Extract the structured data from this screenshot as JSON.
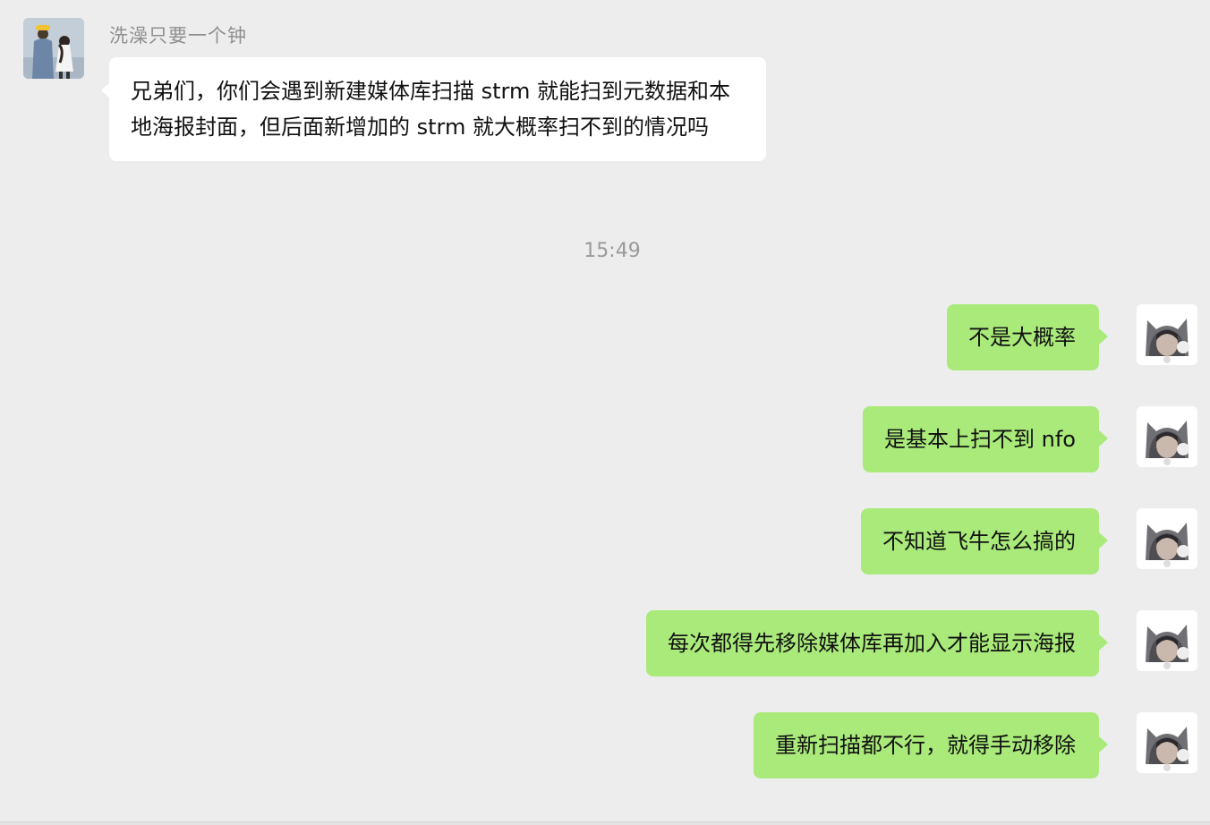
{
  "conversation": {
    "incoming": {
      "sender_name": "洗澡只要一个钟",
      "avatar": "couple-illustration-avatar",
      "text": "兄弟们，你们会遇到新建媒体库扫描 strm 就能扫到元数据和本地海报封面，但后面新增加的 strm 就大概率扫不到的情况吗"
    },
    "timestamp": "15:49",
    "outgoing": [
      {
        "text": "不是大概率"
      },
      {
        "text": "是基本上扫不到 nfo"
      },
      {
        "text": "不知道飞牛怎么搞的"
      },
      {
        "text": "每次都得先移除媒体库再加入才能显示海报"
      },
      {
        "text": "重新扫描都不行，就得手动移除"
      }
    ],
    "my_avatar": "girl-with-cat-hood-avatar"
  },
  "colors": {
    "background": "#ededed",
    "bubble_in": "#ffffff",
    "bubble_out": "#a9ea7a",
    "meta_text": "#8f8f8f"
  }
}
